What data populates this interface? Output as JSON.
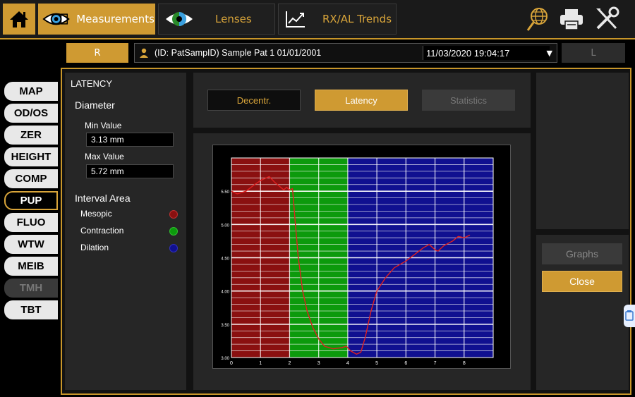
{
  "toolbar": {
    "measurements_label": "Measurements",
    "lenses_label": "Lenses",
    "trends_label": "RX/AL Trends"
  },
  "patient_bar": {
    "right_eye": "R",
    "left_eye": "L",
    "patient": "(ID: PatSampID) Sample Pat 1 01/01/2001",
    "exam_date": "11/03/2020 19:04:17"
  },
  "nav": [
    "MAP",
    "OD/OS",
    "ZER",
    "HEIGHT",
    "COMP",
    "PUP",
    "FLUO",
    "WTW",
    "MEIB",
    "TMH",
    "TBT"
  ],
  "nav_active": "PUP",
  "nav_disabled": "TMH",
  "left_panel": {
    "title": "LATENCY",
    "diameter_label": "Diameter",
    "min_label": "Min Value",
    "min_value": "3.13 mm",
    "max_label": "Max Value",
    "max_value": "5.72 mm",
    "interval_label": "Interval Area",
    "intervals": [
      {
        "label": "Mesopic",
        "color": "#8a1010"
      },
      {
        "label": "Contraction",
        "color": "#0c9a0c"
      },
      {
        "label": "Dilation",
        "color": "#101090"
      }
    ]
  },
  "tabs": {
    "decentr": "Decentr.",
    "latency": "Latency",
    "statistics": "Statistics"
  },
  "right_panel": {
    "graphs_label": "Graphs",
    "close_label": "Close"
  },
  "chart_data": {
    "type": "line",
    "x_range": [
      0,
      9
    ],
    "y_range": [
      3.0,
      6.0
    ],
    "x_ticks": [
      "0",
      "1",
      "2",
      "3",
      "4",
      "5",
      "6",
      "7",
      "8"
    ],
    "y_ticks": [
      {
        "value": 3.0,
        "label": "3.00"
      },
      {
        "value": 3.5,
        "label": "3.50"
      },
      {
        "value": 4.0,
        "label": "4.00"
      },
      {
        "value": 4.5,
        "label": "4.50"
      },
      {
        "value": 5.0,
        "label": "5.00"
      },
      {
        "value": 5.5,
        "label": "5.50"
      }
    ],
    "regions": [
      {
        "name": "Mesopic",
        "from": 0,
        "to": 2,
        "color": "#8a1010"
      },
      {
        "name": "Contraction",
        "from": 2,
        "to": 4,
        "color": "#0c9a0c"
      },
      {
        "name": "Dilation",
        "from": 4,
        "to": 9,
        "color": "#101090"
      }
    ],
    "line_color": "#e02020",
    "series": [
      {
        "values_x": [
          0,
          0.2,
          0.5,
          0.8,
          1.0,
          1.3,
          1.5,
          1.8,
          1.9,
          2.0,
          2.1,
          2.2,
          2.3,
          2.45,
          2.6,
          2.8,
          3.0,
          3.2,
          3.5,
          3.8,
          3.95,
          4.1,
          4.3,
          4.45,
          4.6,
          4.8,
          5.0,
          5.3,
          5.6,
          6.0,
          6.3,
          6.6,
          6.8,
          7.0,
          7.1,
          7.3,
          7.6,
          7.8,
          8.0,
          8.2
        ],
        "values_y": [
          5.5,
          5.46,
          5.5,
          5.6,
          5.66,
          5.72,
          5.63,
          5.52,
          5.56,
          5.52,
          5.54,
          5.0,
          4.5,
          4.0,
          3.7,
          3.45,
          3.28,
          3.17,
          3.13,
          3.15,
          3.17,
          3.1,
          3.05,
          3.08,
          3.3,
          3.7,
          4.0,
          4.2,
          4.35,
          4.45,
          4.55,
          4.65,
          4.7,
          4.62,
          4.6,
          4.68,
          4.75,
          4.82,
          4.8,
          4.84
        ]
      }
    ]
  }
}
